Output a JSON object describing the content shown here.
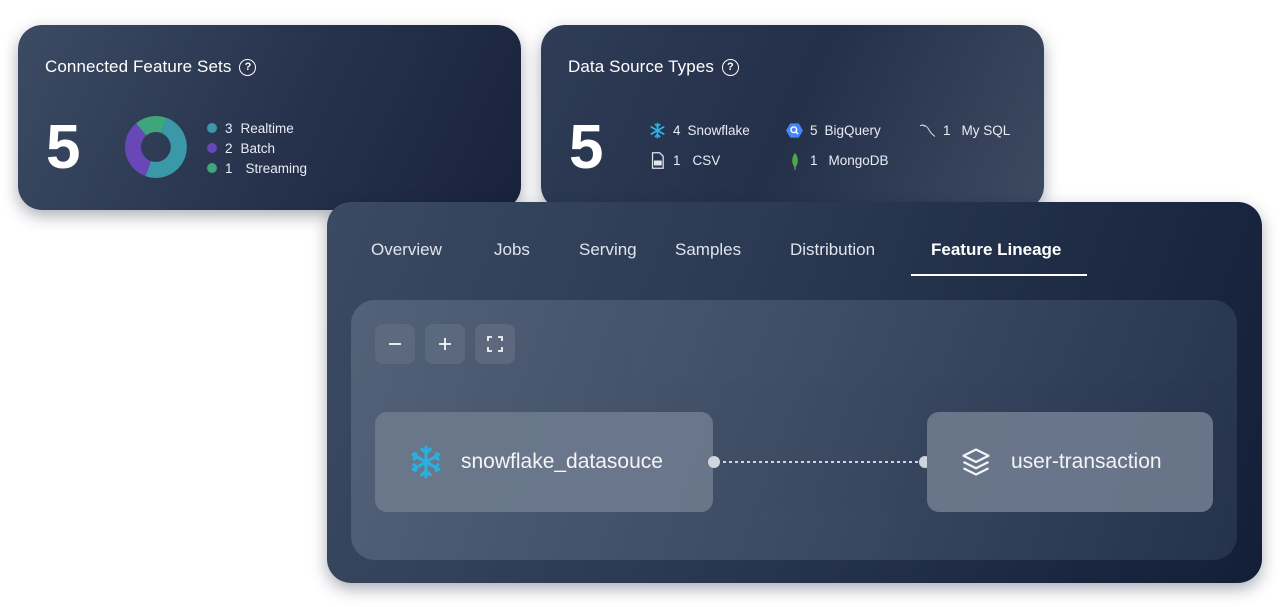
{
  "feature_sets": {
    "title": "Connected Feature Sets",
    "help_glyph": "?",
    "total": "5",
    "legend": [
      {
        "count": "3",
        "label": "Realtime",
        "color": "#3a98a8",
        "value": 3
      },
      {
        "count": "2",
        "label": "Batch",
        "color": "#6848b6",
        "value": 2
      },
      {
        "count": "1",
        "label": "Streaming",
        "color": "#3fa57a",
        "value": 1
      }
    ]
  },
  "data_sources": {
    "title": "Data Source Types",
    "help_glyph": "?",
    "total": "5",
    "items": [
      {
        "icon": "snowflake-icon",
        "count": "4",
        "label": "Snowflake"
      },
      {
        "icon": "bigquery-icon",
        "count": "5",
        "label": "BigQuery"
      },
      {
        "icon": "mysql-icon",
        "count": "1",
        "label": "My SQL"
      },
      {
        "icon": "csv-file-icon",
        "count": "1",
        "label": "CSV"
      },
      {
        "icon": "mongodb-icon",
        "count": "1",
        "label": "MongoDB"
      }
    ]
  },
  "tabs": [
    {
      "label": "Overview"
    },
    {
      "label": "Jobs"
    },
    {
      "label": "Serving"
    },
    {
      "label": "Samples"
    },
    {
      "label": "Distribution"
    },
    {
      "label": "Feature Lineage",
      "active": true
    }
  ],
  "lineage": {
    "controls": [
      "zoom-out-icon",
      "zoom-in-icon",
      "fit-view-icon"
    ],
    "source_node": {
      "label": "snowflake_datasouce",
      "icon": "snowflake-icon"
    },
    "target_node": {
      "label": "user-transaction",
      "icon": "layers-icon"
    }
  },
  "colors": {
    "snowflake": "#29b5e8",
    "bigquery": "#4386fa",
    "mongodb": "#4faa41",
    "accent_underline": "#ffffff"
  }
}
